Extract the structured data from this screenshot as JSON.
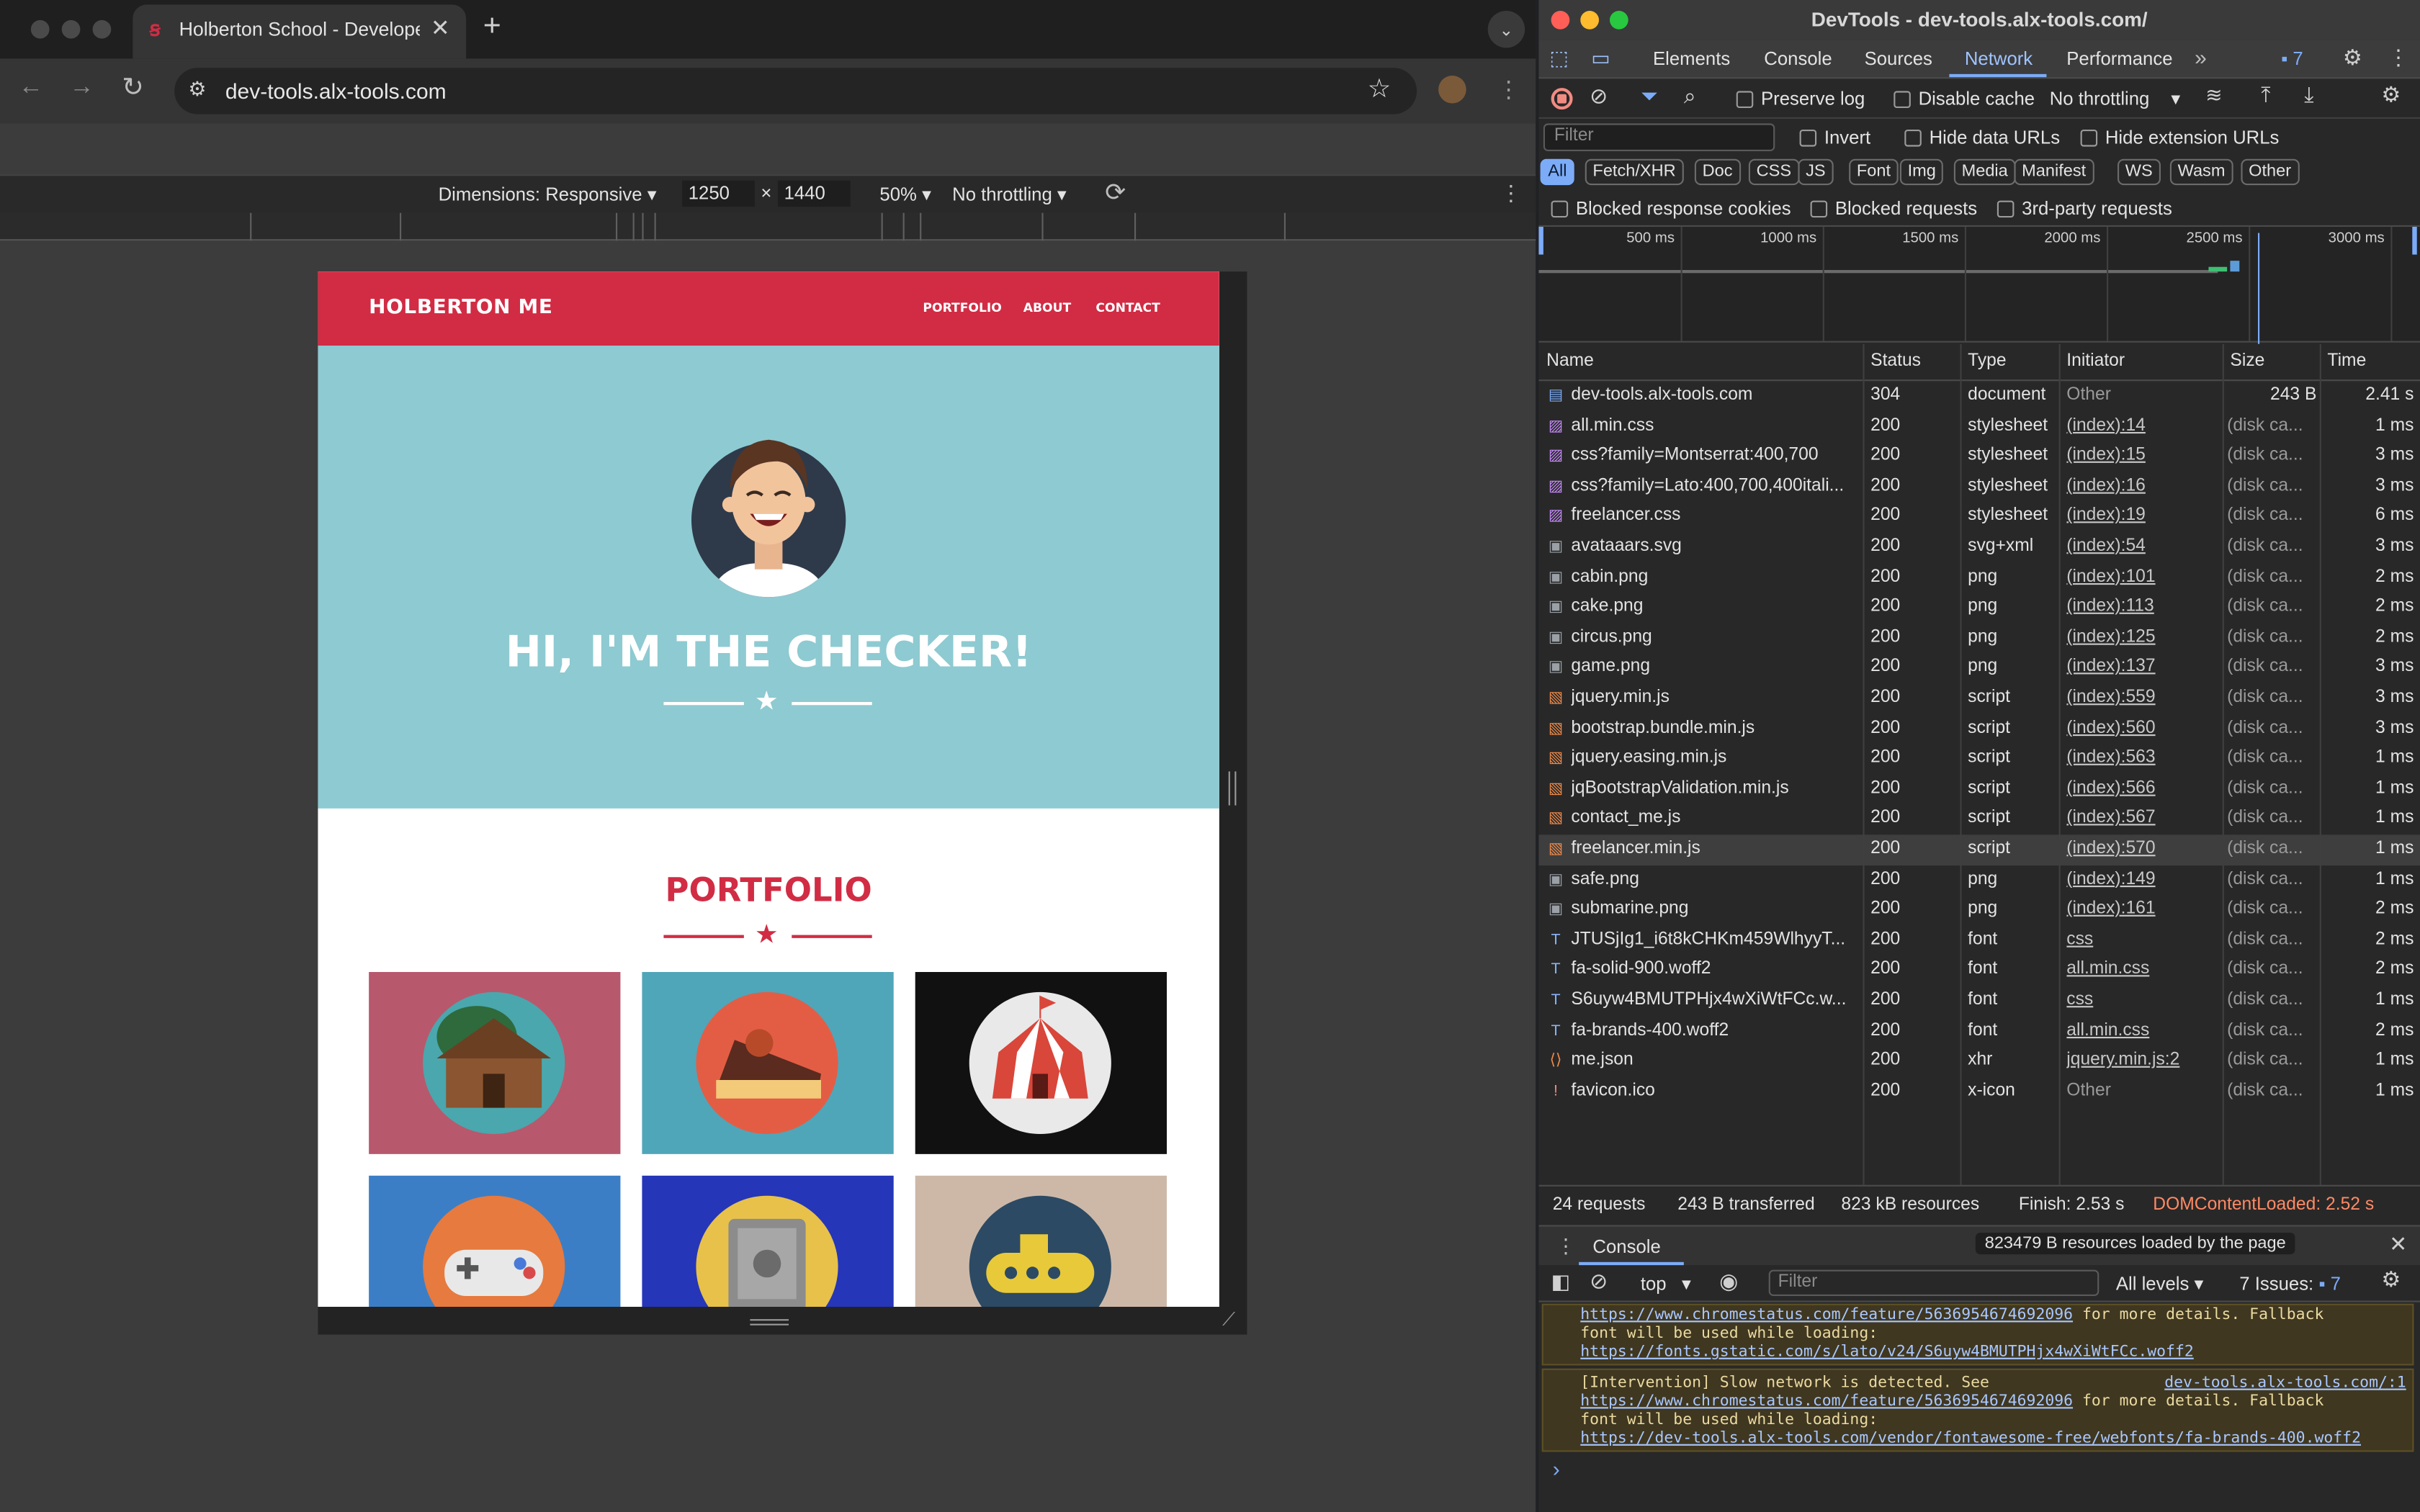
{
  "browser": {
    "tab_title": "Holberton School - Developer Tools",
    "url": "dev-tools.alx-tools.com",
    "new_tab": "+",
    "device_toolbar": {
      "dimensions_label": "Dimensions: Responsive",
      "width": "1250",
      "height": "1440",
      "times": "×",
      "zoom": "50%",
      "throttling": "No throttling"
    }
  },
  "site": {
    "brand": "HOLBERTON ME",
    "nav": [
      "PORTFOLIO",
      "ABOUT",
      "CONTACT"
    ],
    "hero_title": "HI, I'M THE CHECKER!",
    "portfolio_title": "PORTFOLIO",
    "tiles": [
      {
        "name": "cabin",
        "bg": "#b8586d"
      },
      {
        "name": "cake",
        "bg": "#4fa6b9"
      },
      {
        "name": "circus",
        "bg": "#111111"
      },
      {
        "name": "game",
        "bg": "#3b7ec6"
      },
      {
        "name": "safe",
        "bg": "#2536b8"
      },
      {
        "name": "submarine",
        "bg": "#cdb8a8"
      }
    ],
    "colors": {
      "brand_red": "#d12c44",
      "hero_teal": "#8ecad1"
    }
  },
  "devtools": {
    "title": "DevTools - dev-tools.alx-tools.com/",
    "tabs": [
      "Elements",
      "Console",
      "Sources",
      "Network",
      "Performance"
    ],
    "active_tab": "Network",
    "issues_badge": "7",
    "controls": {
      "preserve_log": "Preserve log",
      "disable_cache": "Disable cache",
      "throttling": "No throttling",
      "filter_placeholder": "Filter",
      "invert": "Invert",
      "hide_data_urls": "Hide data URLs",
      "hide_extension_urls": "Hide extension URLs",
      "blocked_response_cookies": "Blocked response cookies",
      "blocked_requests": "Blocked requests",
      "third_party": "3rd-party requests"
    },
    "type_filters": [
      "All",
      "Fetch/XHR",
      "Doc",
      "CSS",
      "JS",
      "Font",
      "Img",
      "Media",
      "Manifest",
      "WS",
      "Wasm",
      "Other"
    ],
    "timeline_ticks": [
      "500 ms",
      "1000 ms",
      "1500 ms",
      "2000 ms",
      "2500 ms",
      "3000 ms"
    ],
    "columns": [
      "Name",
      "Status",
      "Type",
      "Initiator",
      "Size",
      "Time"
    ],
    "requests": [
      {
        "name": "dev-tools.alx-tools.com",
        "status": "304",
        "type": "document",
        "initiator": "Other",
        "size": "243 B",
        "time": "2.41 s",
        "icon": "doc",
        "link": false
      },
      {
        "name": "all.min.css",
        "status": "200",
        "type": "stylesheet",
        "initiator": "(index):14",
        "size": "(disk ca...",
        "time": "1 ms",
        "icon": "css",
        "link": true
      },
      {
        "name": "css?family=Montserrat:400,700",
        "status": "200",
        "type": "stylesheet",
        "initiator": "(index):15",
        "size": "(disk ca...",
        "time": "3 ms",
        "icon": "css",
        "link": true
      },
      {
        "name": "css?family=Lato:400,700,400itali...",
        "status": "200",
        "type": "stylesheet",
        "initiator": "(index):16",
        "size": "(disk ca...",
        "time": "3 ms",
        "icon": "css",
        "link": true
      },
      {
        "name": "freelancer.css",
        "status": "200",
        "type": "stylesheet",
        "initiator": "(index):19",
        "size": "(disk ca...",
        "time": "6 ms",
        "icon": "css",
        "link": true
      },
      {
        "name": "avataaars.svg",
        "status": "200",
        "type": "svg+xml",
        "initiator": "(index):54",
        "size": "(disk ca...",
        "time": "3 ms",
        "icon": "img",
        "link": true
      },
      {
        "name": "cabin.png",
        "status": "200",
        "type": "png",
        "initiator": "(index):101",
        "size": "(disk ca...",
        "time": "2 ms",
        "icon": "img",
        "link": true
      },
      {
        "name": "cake.png",
        "status": "200",
        "type": "png",
        "initiator": "(index):113",
        "size": "(disk ca...",
        "time": "2 ms",
        "icon": "img",
        "link": true
      },
      {
        "name": "circus.png",
        "status": "200",
        "type": "png",
        "initiator": "(index):125",
        "size": "(disk ca...",
        "time": "2 ms",
        "icon": "img",
        "link": true
      },
      {
        "name": "game.png",
        "status": "200",
        "type": "png",
        "initiator": "(index):137",
        "size": "(disk ca...",
        "time": "3 ms",
        "icon": "img",
        "link": true
      },
      {
        "name": "jquery.min.js",
        "status": "200",
        "type": "script",
        "initiator": "(index):559",
        "size": "(disk ca...",
        "time": "3 ms",
        "icon": "js",
        "link": true
      },
      {
        "name": "bootstrap.bundle.min.js",
        "status": "200",
        "type": "script",
        "initiator": "(index):560",
        "size": "(disk ca...",
        "time": "3 ms",
        "icon": "js",
        "link": true
      },
      {
        "name": "jquery.easing.min.js",
        "status": "200",
        "type": "script",
        "initiator": "(index):563",
        "size": "(disk ca...",
        "time": "1 ms",
        "icon": "js",
        "link": true
      },
      {
        "name": "jqBootstrapValidation.min.js",
        "status": "200",
        "type": "script",
        "initiator": "(index):566",
        "size": "(disk ca...",
        "time": "1 ms",
        "icon": "js",
        "link": true
      },
      {
        "name": "contact_me.js",
        "status": "200",
        "type": "script",
        "initiator": "(index):567",
        "size": "(disk ca...",
        "time": "1 ms",
        "icon": "js",
        "link": true
      },
      {
        "name": "freelancer.min.js",
        "status": "200",
        "type": "script",
        "initiator": "(index):570",
        "size": "(disk ca...",
        "time": "1 ms",
        "icon": "js",
        "link": true,
        "selected": true
      },
      {
        "name": "safe.png",
        "status": "200",
        "type": "png",
        "initiator": "(index):149",
        "size": "(disk ca...",
        "time": "1 ms",
        "icon": "img",
        "link": true
      },
      {
        "name": "submarine.png",
        "status": "200",
        "type": "png",
        "initiator": "(index):161",
        "size": "(disk ca...",
        "time": "2 ms",
        "icon": "img",
        "link": true
      },
      {
        "name": "JTUSjIg1_i6t8kCHKm459WlhyyT...",
        "status": "200",
        "type": "font",
        "initiator": "css",
        "size": "(disk ca...",
        "time": "2 ms",
        "icon": "font",
        "link": true
      },
      {
        "name": "fa-solid-900.woff2",
        "status": "200",
        "type": "font",
        "initiator": "all.min.css",
        "size": "(disk ca...",
        "time": "2 ms",
        "icon": "font",
        "link": true
      },
      {
        "name": "S6uyw4BMUTPHjx4wXiWtFCc.w...",
        "status": "200",
        "type": "font",
        "initiator": "css",
        "size": "(disk ca...",
        "time": "1 ms",
        "icon": "font",
        "link": true
      },
      {
        "name": "fa-brands-400.woff2",
        "status": "200",
        "type": "font",
        "initiator": "all.min.css",
        "size": "(disk ca...",
        "time": "2 ms",
        "icon": "font",
        "link": true
      },
      {
        "name": "me.json",
        "status": "200",
        "type": "xhr",
        "initiator": "jquery.min.js:2",
        "size": "(disk ca...",
        "time": "1 ms",
        "icon": "xhr",
        "link": true
      },
      {
        "name": "favicon.ico",
        "status": "200",
        "type": "x-icon",
        "initiator": "Other",
        "size": "(disk ca...",
        "time": "1 ms",
        "icon": "ico",
        "link": false
      }
    ],
    "summary": {
      "requests": "24 requests",
      "transferred": "243 B transferred",
      "resources": "823 kB resources",
      "finish": "Finish: 2.53 s",
      "dcl": "DOMContentLoaded: 2.52 s"
    },
    "console_drawer": {
      "tab": "Console",
      "tooltip": "823479 B resources loaded by the page",
      "context": "top",
      "filter_placeholder": "Filter",
      "levels": "All levels",
      "issues": "7 Issues:",
      "issues_count": "7",
      "msg1": {
        "link1": "https://www.chromestatus.com/feature/5636954674692096",
        "text1": " for more details. Fallback",
        "text2": "font will be used while loading:",
        "link2": "https://fonts.gstatic.com/s/lato/v24/S6uyw4BMUTPHjx4wXiWtFCc.woff2"
      },
      "msg2": {
        "text0": "[Intervention] Slow network is detected. See",
        "source": "dev-tools.alx-tools.com/:1",
        "link1": "https://www.chromestatus.com/feature/5636954674692096",
        "text1": " for more details. Fallback",
        "text2": "font will be used while loading:",
        "link2": "https://dev-tools.alx-tools.com/vendor/fontawesome-free/webfonts/fa-brands-400.woff2"
      },
      "prompt": "›"
    }
  }
}
